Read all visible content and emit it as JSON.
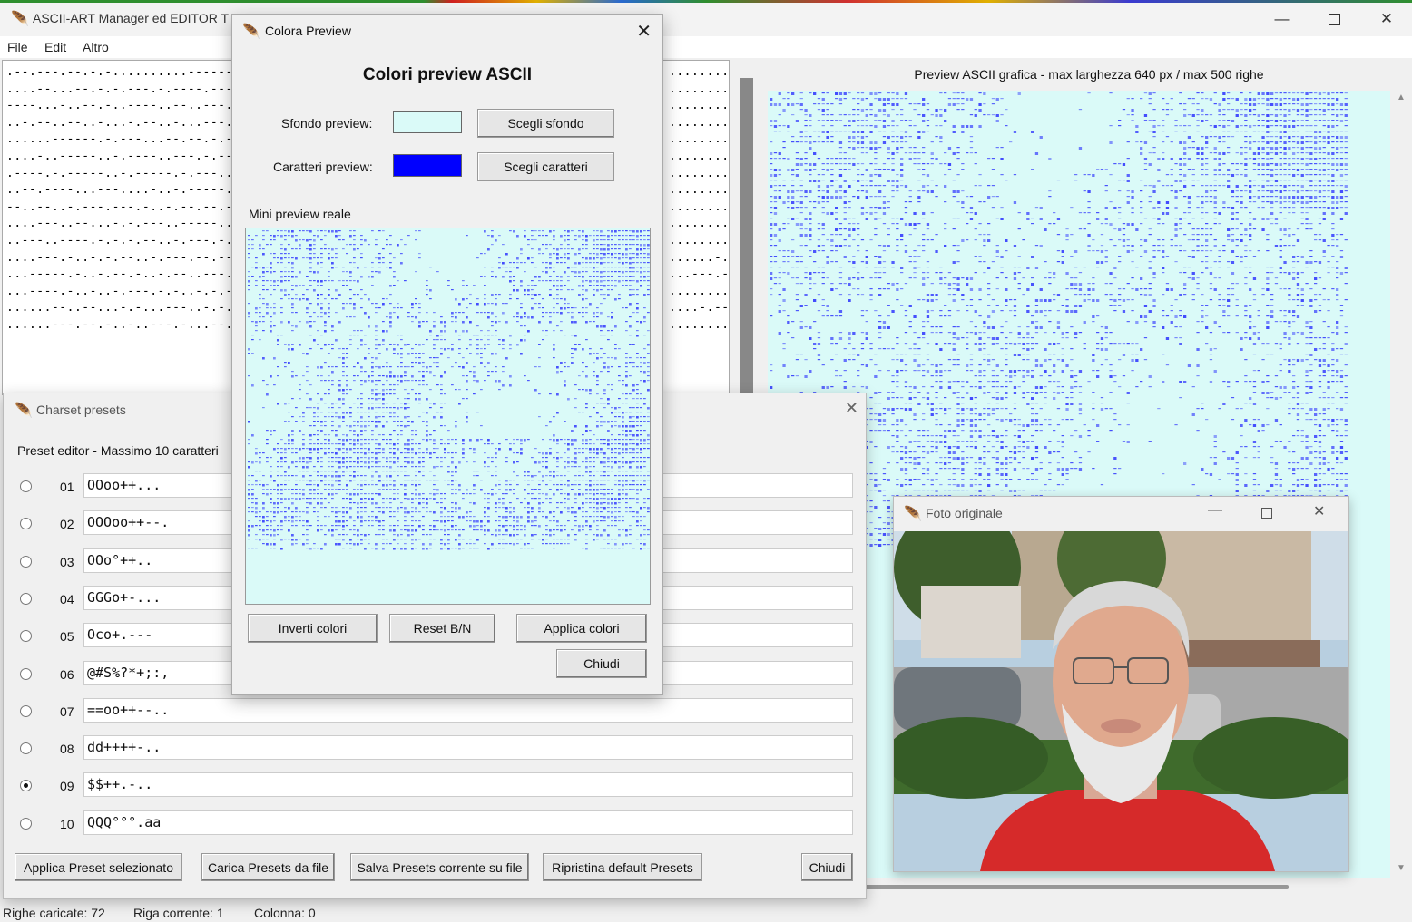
{
  "main_window": {
    "title": "ASCII-ART Manager ed EDITOR T",
    "menu": [
      "File",
      "Edit",
      "Altro"
    ],
    "editor_lines": [
      ".--.---.--.-.-..........------......",
      "....--...--.-.-.---.-.----.---......",
      "----...-..--.-..----..--..---.......",
      "..-.--..--..-...-.--..-...---.-.....",
      "......------.-.---...--.--.-.-......",
      "....-..-----..-.----..---.-.--......",
      ".----.-.-----..-.-----.-.---..-.....",
      "..--.----...---....-..-.-----.......",
      "--..--..-.---.---.-..-.--.--.-......",
      "....---..--...-.-.---..-----........",
      "..---..----.-.-.-.--..-.---.-.......",
      "....---.-..-.-.--..-.---.--.--......",
      "...-----.-..-.--.-..-.--..---.......",
      "...----.-..-..-.---.-.-..-.-.-......",
      "......--..--...-.-...---..-.-.......",
      "......---.--.-..-..---.-...--......."
    ],
    "editor_right_lines": [
      ".........",
      ".........",
      ".........",
      ".........",
      ".........",
      ".........",
      ".........",
      ".........",
      ".........",
      ".........",
      ".........",
      "......-..",
      "...---.--",
      ".........",
      "....-.---",
      "........."
    ],
    "preview_label": "Preview ASCII grafica - max larghezza 640 px / max 500 righe",
    "status": {
      "righe": "Righe caricate: 72",
      "riga": "Riga corrente: 1",
      "colonna": "Colonna: 0"
    }
  },
  "charset_presets": {
    "title": "Charset presets",
    "header": "Preset editor - Massimo 10 caratteri",
    "presets": [
      {
        "num": "01",
        "value": "OOoo++..."
      },
      {
        "num": "02",
        "value": "OOOoo++--."
      },
      {
        "num": "03",
        "value": "OOo°++.."
      },
      {
        "num": "04",
        "value": "GGGo+-..."
      },
      {
        "num": "05",
        "value": "Oco+.---"
      },
      {
        "num": "06",
        "value": "@#S%?*+;:,"
      },
      {
        "num": "07",
        "value": "==oo++--.."
      },
      {
        "num": "08",
        "value": "dd++++-.."
      },
      {
        "num": "09",
        "value": "$$++.-.."
      },
      {
        "num": "10",
        "value": "QQQ°°°.aa"
      }
    ],
    "selected_index": 8,
    "buttons": {
      "apply": "Applica Preset selezionato",
      "load": "Carica Presets da file",
      "save": "Salva Presets corrente su file",
      "restore": "Ripristina default Presets",
      "close": "Chiudi"
    }
  },
  "colora_preview": {
    "title": "Colora Preview",
    "heading": "Colori preview ASCII",
    "sfondo_label": "Sfondo preview:",
    "caratteri_label": "Caratteri preview:",
    "sfondo_color": "#dafaf8",
    "caratteri_color": "#0000ff",
    "btn_sfondo": "Scegli sfondo",
    "btn_caratteri": "Scegli caratteri",
    "mini_label": "Mini preview reale",
    "btn_inverti": "Inverti colori",
    "btn_reset": "Reset B/N",
    "btn_applica": "Applica colori",
    "btn_chiudi": "Chiudi"
  },
  "foto_originale": {
    "title": "Foto originale"
  }
}
